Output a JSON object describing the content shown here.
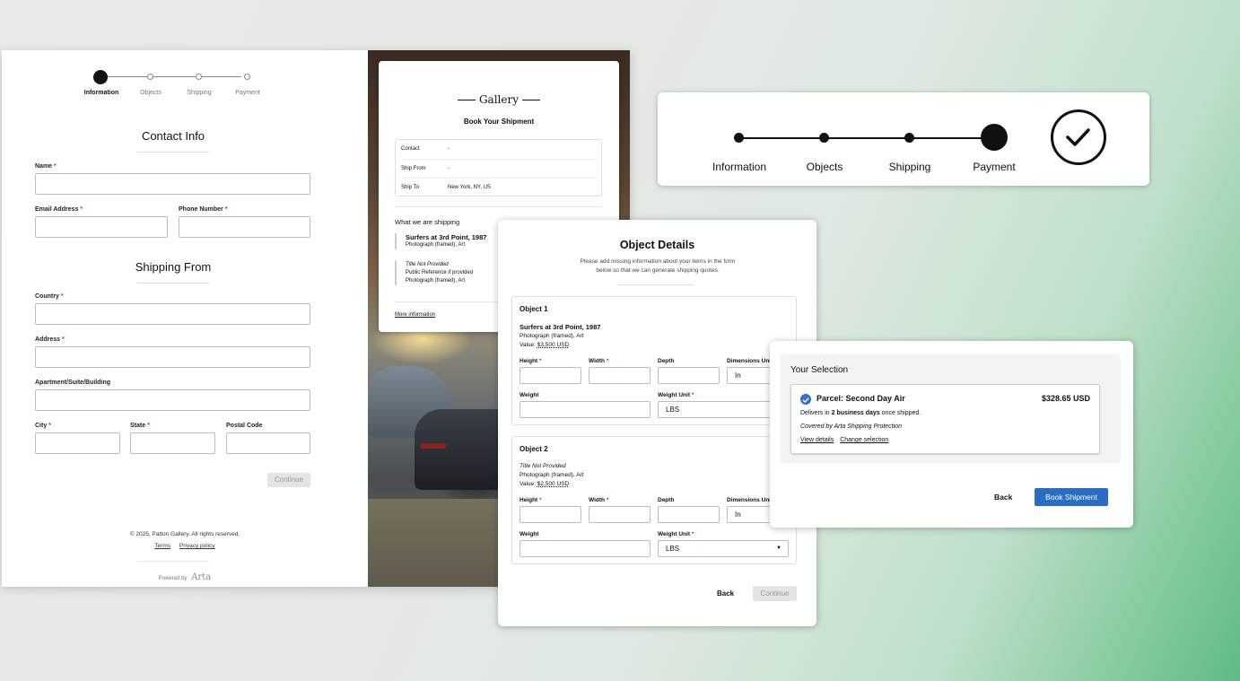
{
  "steps": [
    "Information",
    "Objects",
    "Shipping",
    "Payment"
  ],
  "contact": {
    "title": "Contact Info",
    "name_label": "Name",
    "email_label": "Email Address",
    "phone_label": "Phone Number"
  },
  "shipping_from": {
    "title": "Shipping From",
    "country_label": "Country",
    "address_label": "Address",
    "apt_label": "Apartment/Suite/Building",
    "city_label": "City",
    "state_label": "State",
    "postal_label": "Postal Code"
  },
  "required_mark": "*",
  "continue_label": "Continue",
  "footer": {
    "copyright": "© 2025, Patton Gallery. All rights reserved.",
    "terms": "Terms",
    "privacy": "Privacy policy",
    "powered_by": "Powered by",
    "brand": "Arta"
  },
  "gallery": {
    "logo": "Gallery",
    "subtitle": "Book Your Shipment",
    "summary": [
      {
        "key": "Contact",
        "value": "-"
      },
      {
        "key": "Ship From",
        "value": "-"
      },
      {
        "key": "Ship To",
        "value": "New York, NY, US"
      }
    ],
    "shipping_heading": "What we are shipping",
    "items": [
      {
        "title": "Surfers at 3rd Point, 1987",
        "line1": "Photograph (framed), Art"
      },
      {
        "title": "Title Not Provided",
        "line1": "Public Reference if provided",
        "line2": "Photograph (framed), Art"
      }
    ],
    "more_info": "More information"
  },
  "object_details": {
    "title": "Object Details",
    "description": "Please add missing information about your items in the form below so that we can generate shipping quotes.",
    "objects": [
      {
        "heading": "Object 1",
        "title": "Surfers at 3rd Point, 1987",
        "type": "Photograph (framed), Art",
        "value_label": "Value:",
        "value": "$3,500 USD"
      },
      {
        "heading": "Object 2",
        "title": "Title Not Provided",
        "type": "Photograph (framed), Art",
        "value_label": "Value:",
        "value": "$2,500 USD"
      }
    ],
    "height_label": "Height",
    "width_label": "Width",
    "depth_label": "Depth",
    "dim_unit_label": "Dimensions Unit",
    "dim_unit_value": "In",
    "weight_label": "Weight",
    "weight_unit_label": "Weight Unit",
    "weight_unit_value": "LBS",
    "back_label": "Back",
    "continue_label": "Continue"
  },
  "selection": {
    "heading": "Your Selection",
    "rate": "Parcel: Second Day Air",
    "price": "$328.65 USD",
    "delivers_prefix": "Delivers in ",
    "delivers_bold": "2 business days",
    "delivers_suffix": " once shipped.",
    "coverage": "Covered by Arta Shipping Protection",
    "view_details": "View details",
    "change_selection": "Change selection",
    "back_label": "Back",
    "book_label": "Book Shipment"
  },
  "colors": {
    "accent_blue": "#2a6dc4",
    "required_red": "#d0243a"
  }
}
